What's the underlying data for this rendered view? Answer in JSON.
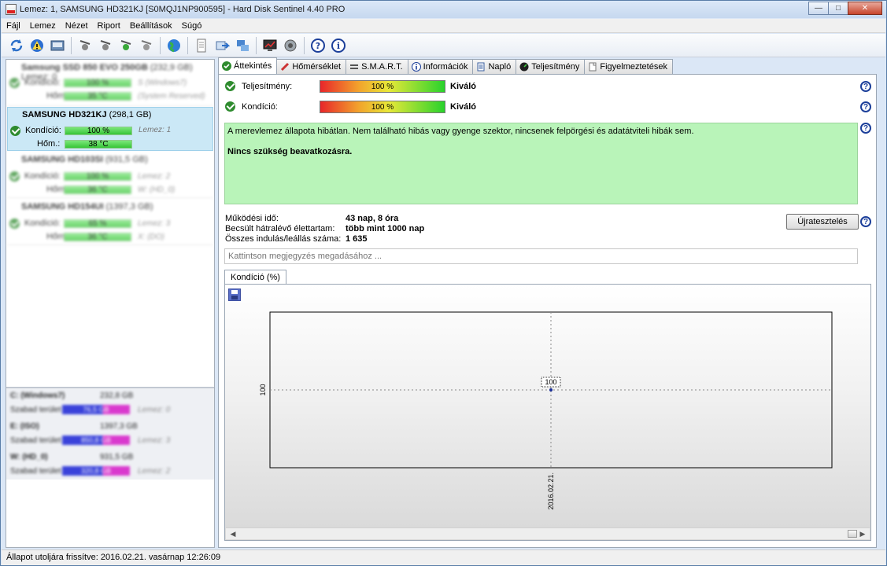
{
  "window": {
    "title": "Lemez: 1, SAMSUNG HD321KJ [S0MQJ1NP900595]  -  Hard Disk Sentinel 4.40 PRO",
    "minimize": "—",
    "maximize": "□",
    "close": "✕"
  },
  "menu": [
    "Fájl",
    "Lemez",
    "Nézet",
    "Riport",
    "Beállítások",
    "Súgó"
  ],
  "toolbar": {
    "icons": [
      "refresh-icon",
      "alert-icon",
      "drive-icon",
      "satellite-1-icon",
      "satellite-2-icon",
      "satellite-3-icon",
      "satellite-4-icon",
      "globe-icon",
      "report-icon",
      "send-icon",
      "network-icon",
      "monitor-icon",
      "sound-icon",
      "help-icon",
      "info-icon"
    ]
  },
  "disks": [
    {
      "name": "Samsung SSD 850 EVO 250GB",
      "size": "(232,9 GB)",
      "note": "Lemez: 0",
      "condition_label": "Kondíció:",
      "condition": "100 %",
      "condition_note": "S (Windows7)",
      "temp_label": "Hőm.:",
      "temp": "35 °C",
      "temp_note": "(System Reserved)",
      "blurred": true
    },
    {
      "name": "SAMSUNG HD321KJ",
      "size": "(298,1 GB)",
      "note": "",
      "condition_label": "Kondíció:",
      "condition": "100 %",
      "condition_note": "Lemez: 1",
      "temp_label": "Hőm.:",
      "temp": "38 °C",
      "temp_note": "",
      "blurred": false
    },
    {
      "name": "SAMSUNG HD103SI",
      "size": "(931,5 GB)",
      "note": "",
      "condition_label": "Kondíció:",
      "condition": "100 %",
      "condition_note": "Lemez: 2",
      "temp_label": "Hőm.:",
      "temp": "36 °C",
      "temp_note": "W: (HD_0)",
      "blurred": true
    },
    {
      "name": "SAMSUNG HD154UI",
      "size": "(1397,3 GB)",
      "note": "",
      "condition_label": "Kondíció:",
      "condition": "65 %",
      "condition_note": "Lemez: 3",
      "temp_label": "Hőm.:",
      "temp": "36 °C",
      "temp_note": "X: (DO)",
      "blurred": true
    }
  ],
  "partitions": [
    {
      "name": "C: (Windows7)",
      "size": "232,8 GB",
      "free_label": "Szabad terület",
      "free": "76,5 GB",
      "note": "Lemez: 0",
      "fill": 0.6
    },
    {
      "name": "E: (ISO)",
      "size": "1397,3 GB",
      "free_label": "Szabad terület",
      "free": "850,8 GB",
      "note": "Lemez: 3",
      "fill": 0.6
    },
    {
      "name": "W: (HD_0)",
      "size": "931,5 GB",
      "free_label": "Szabad terület",
      "free": "320,8 GB",
      "note": "Lemez: 2",
      "fill": 0.6
    }
  ],
  "tabs": [
    {
      "label": "Áttekintés",
      "icon": "check-icon",
      "active": true
    },
    {
      "label": "Hőmérséklet",
      "icon": "thermometer-icon",
      "active": false
    },
    {
      "label": "S.M.A.R.T.",
      "icon": "smart-icon",
      "active": false
    },
    {
      "label": "Információk",
      "icon": "info-icon",
      "active": false
    },
    {
      "label": "Napló",
      "icon": "log-icon",
      "active": false
    },
    {
      "label": "Teljesítmény",
      "icon": "gauge-icon",
      "active": false
    },
    {
      "label": "Figyelmeztetések",
      "icon": "alert-icon",
      "active": false
    }
  ],
  "overview": {
    "performance_label": "Teljesítmény:",
    "performance_value": "100 %",
    "performance_rating": "Kiváló",
    "condition_label": "Kondíció:",
    "condition_value": "100 %",
    "condition_rating": "Kiváló",
    "status_text": "A merevlemez állapota hibátlan. Nem található hibás vagy gyenge szektor, nincsenek felpörgési és adatátviteli hibák sem.",
    "status_action": "Nincs szükség beavatkozásra.",
    "uptime_label": "Működési idő:",
    "uptime_value": "43 nap, 8 óra",
    "lifetime_label": "Becsült hátralévő élettartam:",
    "lifetime_value": "több mint 1000 nap",
    "startstop_label": "Összes indulás/leállás száma:",
    "startstop_value": "1 635",
    "retest_button": "Újratesztelés",
    "note_placeholder": "Kattintson megjegyzés megadásához ...",
    "chart_tab": "Kondíció  (%)",
    "help": "?"
  },
  "chart_data": {
    "type": "line",
    "x": [
      "2016.02.21."
    ],
    "series": [
      {
        "values": [
          100
        ]
      }
    ],
    "y_tick_labels": [
      "100"
    ],
    "x_tick_labels": [
      "2016.02.21."
    ],
    "data_labels": [
      "100"
    ],
    "title": "",
    "xlabel": "",
    "ylabel": "",
    "grid": true
  },
  "statusbar": {
    "text": "Állapot utoljára frissítve: 2016.02.21. vasárnap 12:26:09"
  },
  "colors": {
    "selected_bg": "#cbe8f6",
    "status_bg": "#b9f4b9",
    "bar_green": "#37c437",
    "partition_used": "#1a24d6",
    "partition_free": "#d61ac8"
  }
}
